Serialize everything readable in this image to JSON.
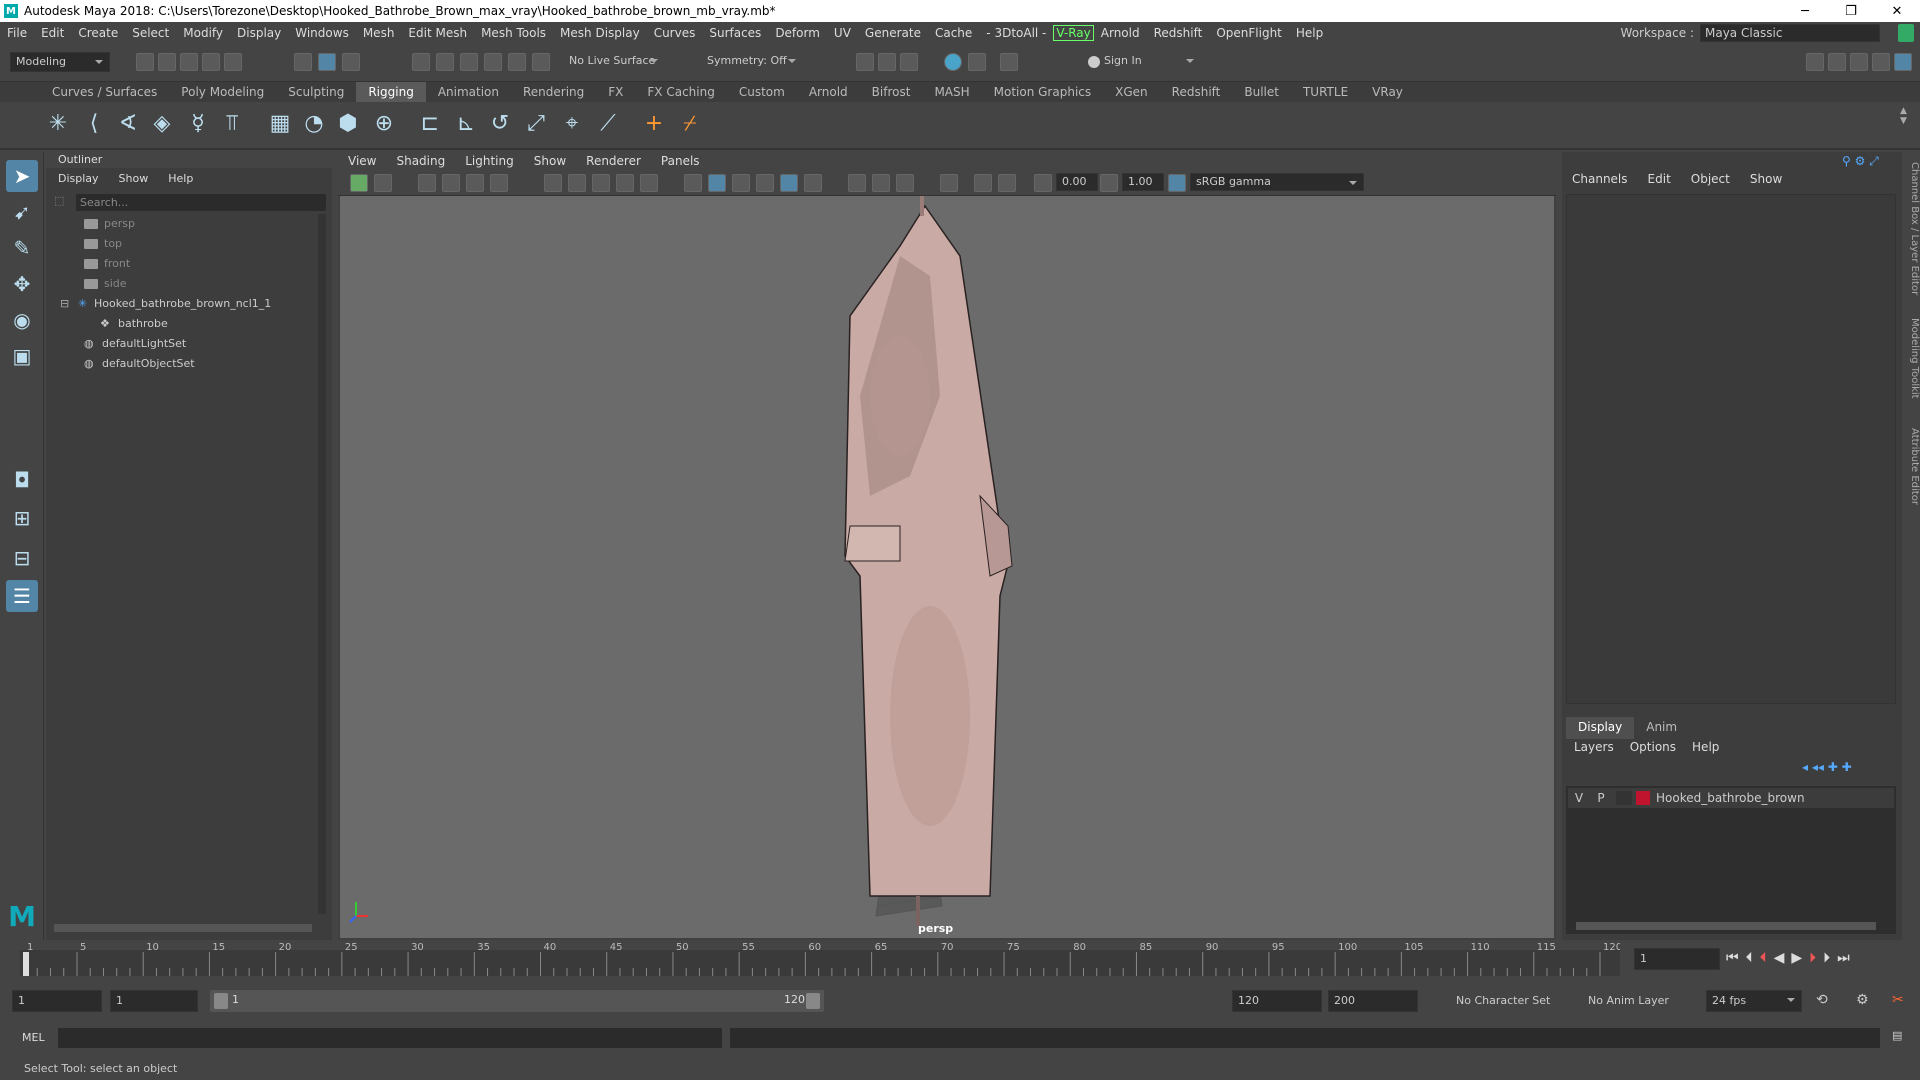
{
  "titlebar": {
    "title": "Autodesk Maya 2018: C:\\Users\\Torezone\\Desktop\\Hooked_Bathrobe_Brown_max_vray\\Hooked_bathrobe_brown_mb_vray.mb*"
  },
  "menubar": {
    "items": [
      "File",
      "Edit",
      "Create",
      "Select",
      "Modify",
      "Display",
      "Windows",
      "Mesh",
      "Edit Mesh",
      "Mesh Tools",
      "Mesh Display",
      "Curves",
      "Surfaces",
      "Deform",
      "UV",
      "Generate",
      "Cache",
      "- 3DtoAll -",
      "V-Ray",
      "Arnold",
      "Redshift",
      "OpenFlight",
      "Help"
    ],
    "workspace_label": "Workspace :",
    "workspace_value": "Maya Classic"
  },
  "statusline": {
    "mode": "Modeling",
    "live_surface": "No Live Surface",
    "symmetry": "Symmetry: Off",
    "sign_in": "Sign In"
  },
  "shelf": {
    "tabs": [
      "Curves / Surfaces",
      "Poly Modeling",
      "Sculpting",
      "Rigging",
      "Animation",
      "Rendering",
      "FX",
      "FX Caching",
      "Custom",
      "Arnold",
      "Bifrost",
      "MASH",
      "Motion Graphics",
      "XGen",
      "Redshift",
      "Bullet",
      "TURTLE",
      "VRay"
    ],
    "active_tab": "Rigging"
  },
  "outliner": {
    "title": "Outliner",
    "menu": [
      "Display",
      "Show",
      "Help"
    ],
    "search_placeholder": "Search...",
    "items": [
      {
        "label": "persp"
      },
      {
        "label": "top"
      },
      {
        "label": "front"
      },
      {
        "label": "side"
      },
      {
        "label": "Hooked_bathrobe_brown_ncl1_1"
      },
      {
        "label": "bathrobe"
      },
      {
        "label": "defaultLightSet"
      },
      {
        "label": "defaultObjectSet"
      }
    ]
  },
  "viewport": {
    "menu": [
      "View",
      "Shading",
      "Lighting",
      "Show",
      "Renderer",
      "Panels"
    ],
    "exposure": "0.00",
    "gamma": "1.00",
    "color_space": "sRGB gamma",
    "camera_label": "persp"
  },
  "channelbox": {
    "menu": [
      "Channels",
      "Edit",
      "Object",
      "Show"
    ]
  },
  "layers": {
    "tabs": [
      "Display",
      "Anim"
    ],
    "menu": [
      "Layers",
      "Options",
      "Help"
    ],
    "layer": {
      "v": "V",
      "p": "P",
      "name": "Hooked_bathrobe_brown",
      "color": "#c0142e"
    }
  },
  "sidetabs": [
    "Channel Box / Layer Editor",
    "Modeling Toolkit",
    "Attribute Editor"
  ],
  "timeline": {
    "ticks": [
      "1",
      "5",
      "10",
      "15",
      "20",
      "25",
      "30",
      "35",
      "40",
      "45",
      "50",
      "55",
      "60",
      "65",
      "70",
      "75",
      "80",
      "85",
      "90",
      "95",
      "100",
      "105",
      "110",
      "115",
      "120"
    ],
    "current_frame": "1"
  },
  "range": {
    "start": "1",
    "playback_start": "1",
    "slider_start": "1",
    "slider_end": "120",
    "playback_end": "120",
    "end": "200",
    "character_set": "No Character Set",
    "anim_layer": "No Anim Layer",
    "fps": "24 fps"
  },
  "mel": {
    "label": "MEL"
  },
  "helpline": {
    "text": "Select Tool: select an object"
  }
}
